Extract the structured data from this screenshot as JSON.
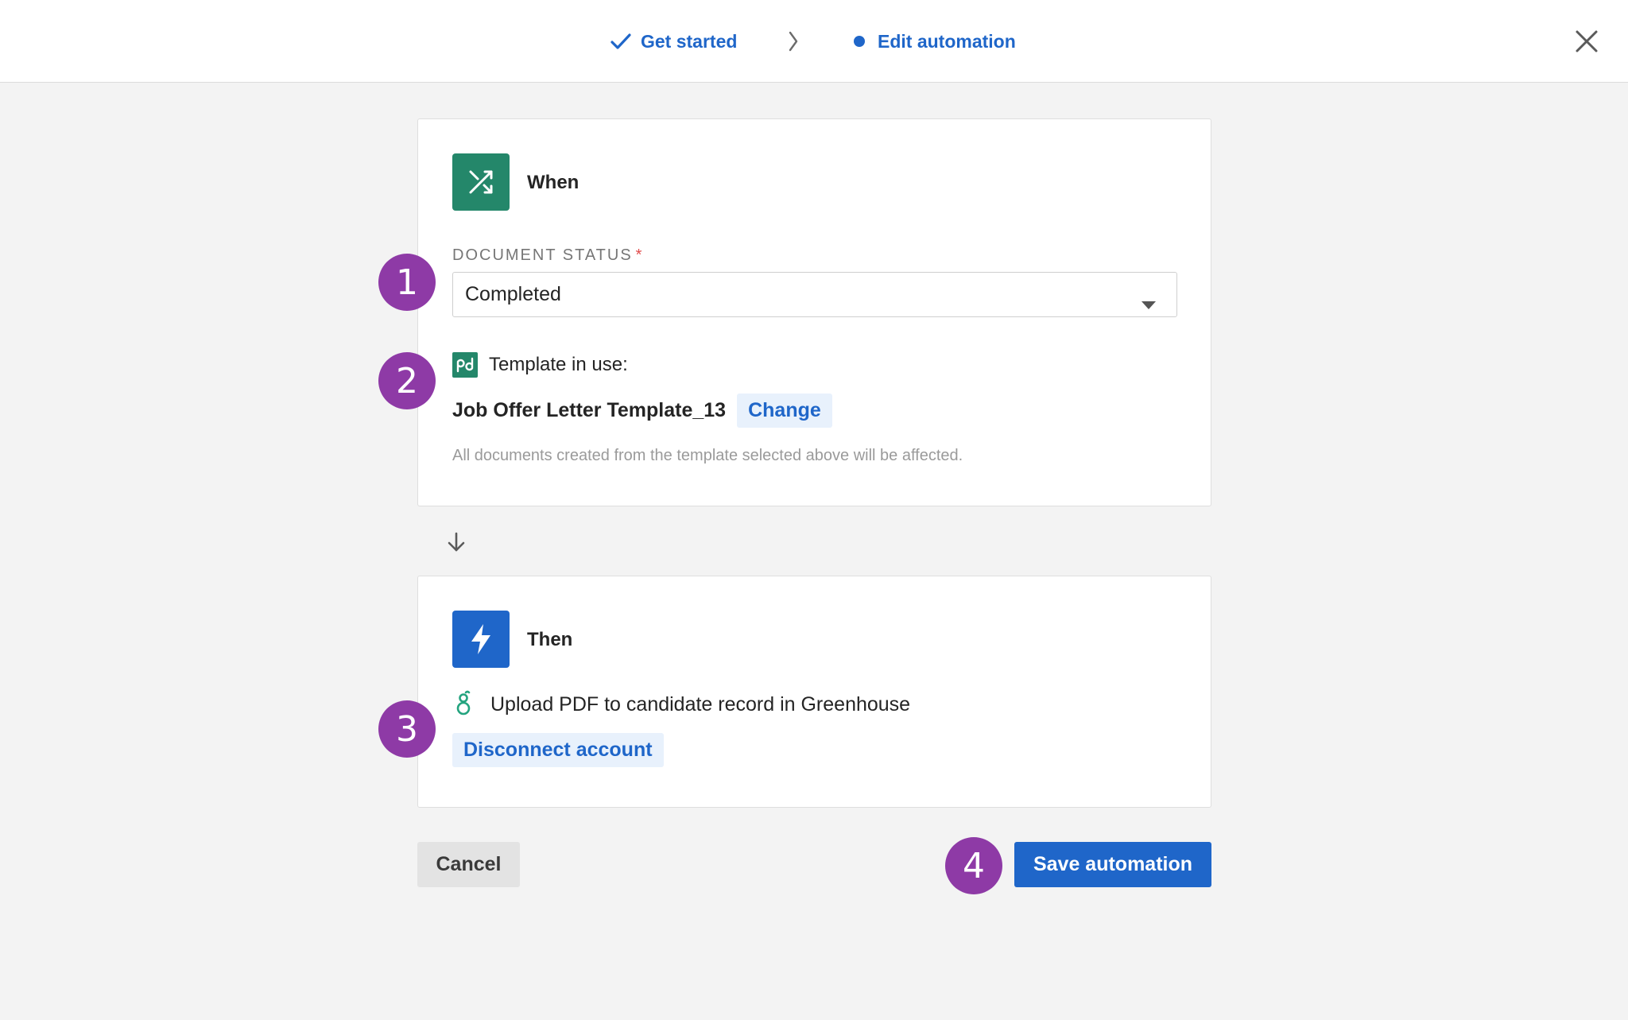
{
  "header": {
    "steps": [
      {
        "label": "Get started",
        "state": "completed",
        "icon": "check-icon"
      },
      {
        "label": "Edit automation",
        "state": "current",
        "icon": "dot-icon"
      }
    ],
    "separator_icon": "chevron-right-icon",
    "close_icon": "close-icon"
  },
  "when_card": {
    "heading": "When",
    "icon": "shuffle-icon",
    "document_status": {
      "label": "DOCUMENT STATUS",
      "required_marker": "*",
      "value": "Completed"
    },
    "template": {
      "label": "Template in use:",
      "name": "Job Offer Letter Template_13",
      "change_label": "Change",
      "helper_text": "All documents created from the template selected above will be affected."
    }
  },
  "then_card": {
    "heading": "Then",
    "icon": "lightning-icon",
    "action": {
      "text": "Upload PDF to candidate record in Greenhouse",
      "icon": "greenhouse-icon",
      "disconnect_label": "Disconnect account"
    }
  },
  "footer": {
    "cancel_label": "Cancel",
    "save_label": "Save automation"
  },
  "callouts": [
    "1",
    "2",
    "3",
    "4"
  ],
  "colors": {
    "brand_blue": "#1f66c9",
    "brand_green": "#24876a",
    "callout_purple": "#8e3aa6",
    "required_red": "#e14c4c"
  }
}
